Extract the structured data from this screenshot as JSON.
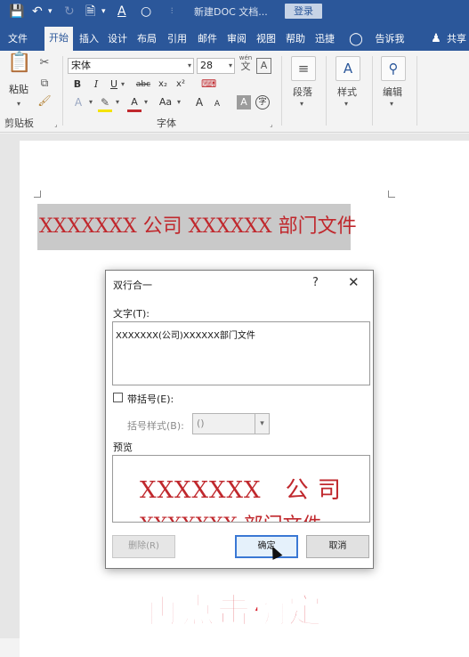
{
  "app": {
    "title": "新建DOC 文档...",
    "login_label": "登录",
    "accent": "#2b579a"
  },
  "quick_access": {
    "save_icon": "save-icon",
    "undo_icon": "undo-icon",
    "redo_icon": "redo-icon",
    "new_icon": "new-document-icon",
    "font_color_icon": "font-color-icon",
    "shape_icon": "circle-icon",
    "customize_icon": "customize-icon"
  },
  "tabs": [
    {
      "label": "文件"
    },
    {
      "label": "开始"
    },
    {
      "label": "插入"
    },
    {
      "label": "设计"
    },
    {
      "label": "布局"
    },
    {
      "label": "引用"
    },
    {
      "label": "邮件"
    },
    {
      "label": "审阅"
    },
    {
      "label": "视图"
    },
    {
      "label": "帮助"
    },
    {
      "label": "迅捷"
    }
  ],
  "tell_me": "告诉我",
  "share": "共享",
  "ribbon": {
    "paste_label": "粘贴",
    "clipboard_label": "剪贴板",
    "font_name": "宋体",
    "font_size": "28",
    "wen_label": "wén",
    "wen_char": "文",
    "a_box": "A",
    "bold": "B",
    "italic": "I",
    "underline": "U",
    "strike": "abc",
    "sub": "x₂",
    "sup": "x²",
    "font_color_a": "A",
    "case": "Aa",
    "grow": "A",
    "shrink": "A",
    "char_shade": "A",
    "circled": "字",
    "font_group_label": "字体",
    "paragraph_label": "段落",
    "styles_label": "样式",
    "editing_label": "编辑"
  },
  "document": {
    "text": "XXXXXXX 公司 XXXXXX 部门文件"
  },
  "dialog": {
    "title": "双行合一",
    "help": "?",
    "close": "✕",
    "text_label": "文字(T):",
    "text_value": "XXXXXXX(公司)XXXXXX部门文件",
    "bracket_checkbox_label": "带括号(E):",
    "bracket_style_label": "括号样式(B):",
    "bracket_style_value": "()",
    "preview_label": "预览",
    "preview_top": "XXXXXXX　公 司",
    "preview_bottom": "XXXXXXX 部门文件",
    "delete_button": "删除(R)",
    "ok_button": "确定",
    "cancel_button": "取消"
  },
  "caption": "再点击确定"
}
